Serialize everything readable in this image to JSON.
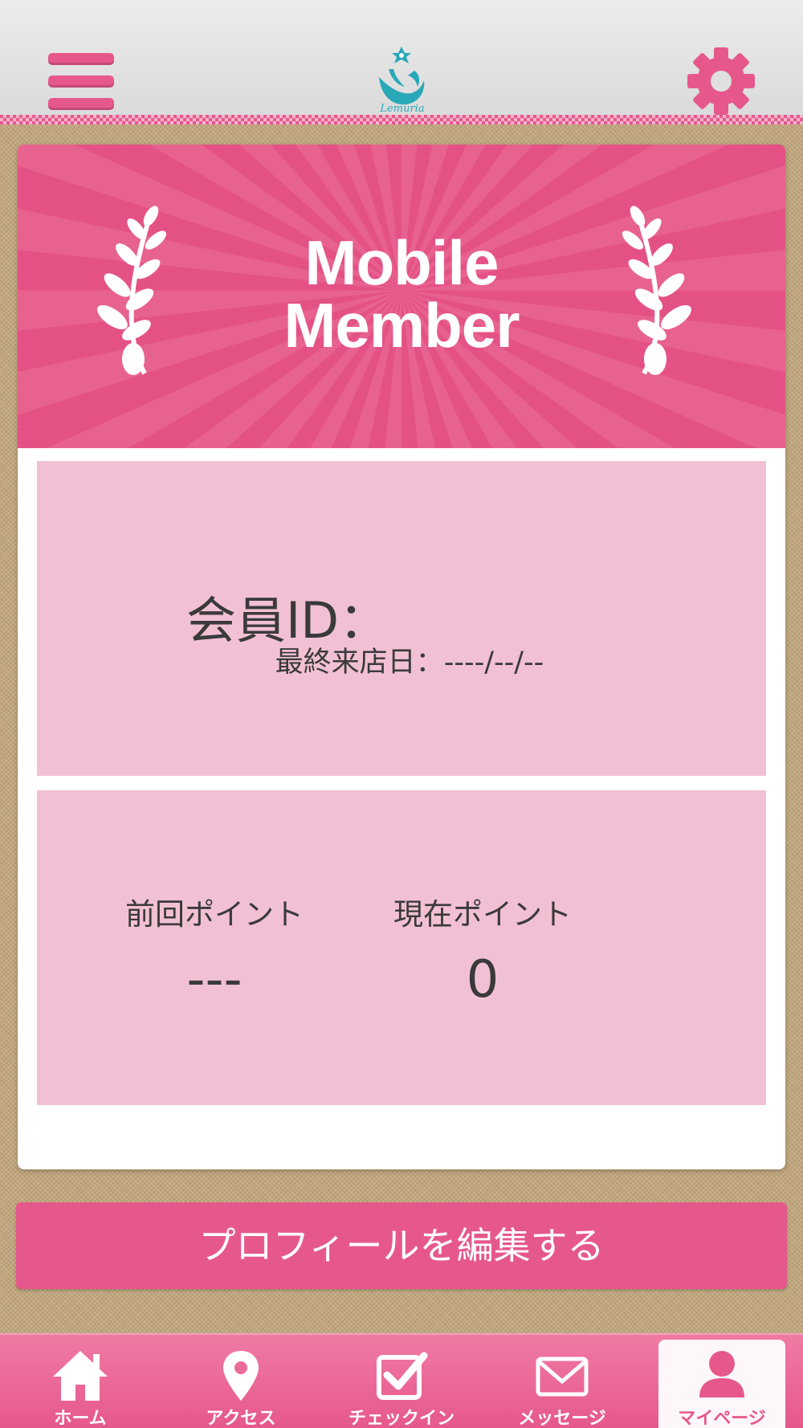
{
  "header": {
    "menu_icon": "hamburger-menu-icon",
    "logo_icon": "lemuria-logo",
    "logo_text": "Lemuria",
    "settings_icon": "gear-icon",
    "accent_color": "#e6588c",
    "logo_color": "#29a8b8"
  },
  "banner": {
    "title_line1": "Mobile",
    "title_line2": "Member",
    "decoration_icon": "laurel-branch-icon"
  },
  "member": {
    "id_label": "会員ID：",
    "last_visit_label": "最終来店日：",
    "last_visit_value": "----/--/--"
  },
  "points": {
    "previous_label": "前回ポイント",
    "previous_value": "---",
    "current_label": "現在ポイント",
    "current_value": "0"
  },
  "edit_profile_label": "プロフィールを編集する",
  "nav": {
    "items": [
      {
        "label": "ホーム",
        "icon": "home-icon"
      },
      {
        "label": "アクセス",
        "icon": "map-pin-icon"
      },
      {
        "label": "チェックイン",
        "icon": "checkbox-icon"
      },
      {
        "label": "メッセージ",
        "icon": "envelope-icon"
      },
      {
        "label": "マイページ",
        "icon": "user-icon",
        "active": true
      }
    ]
  }
}
